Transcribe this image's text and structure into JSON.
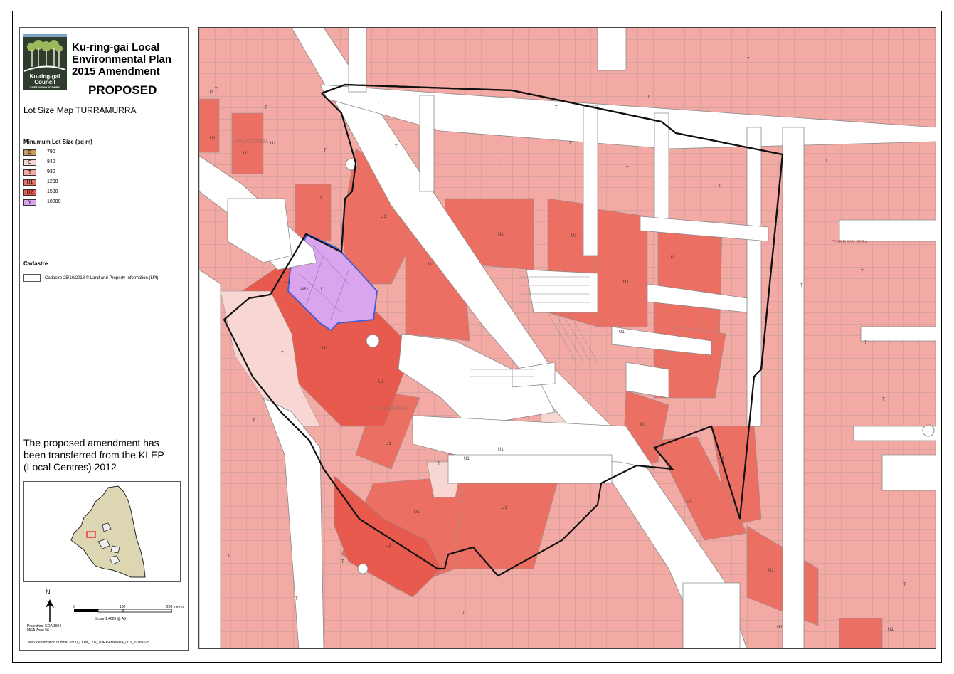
{
  "logo": {
    "name": "Ku-ring-gai",
    "sub": "Council",
    "tagline": "SUSTAINING SYDNEY"
  },
  "header": {
    "title_lines": [
      "Ku-ring-gai Local",
      "Environmental Plan",
      "2015 Amendment"
    ],
    "status": "PROPOSED",
    "map_title": "Lot Size Map TURRAMURRA"
  },
  "legend": {
    "heading": "Minumum Lot Size (sq m)",
    "items": [
      {
        "code": "Q",
        "value": "790",
        "color": "#c99c5a"
      },
      {
        "code": "S",
        "value": "840",
        "color": "#f7d6d3"
      },
      {
        "code": "T",
        "value": "930",
        "color": "#f3a9a4"
      },
      {
        "code": "U1",
        "value": "1200",
        "color": "#ec6f63"
      },
      {
        "code": "U2",
        "value": "1500",
        "color": "#e85a4e"
      },
      {
        "code": "Y",
        "value": "10000",
        "color": "#dba4ee"
      }
    ]
  },
  "cadastre": {
    "heading": "Cadastre",
    "item": "Cadastre 25/10/2018 © Land and Property Information (LPI)"
  },
  "note": "The proposed amendment has been transferred from the KLEP (Local Centres) 2012",
  "north": "N",
  "scale": {
    "zero": "0",
    "mid": "100",
    "max": "200 metres",
    "text": "Scale 1:4620 @ A3"
  },
  "projection": [
    "Projection: GDA 1994",
    "MGA Zone 56"
  ],
  "map_id": "Map identification number   6500_COM_LZN_TURRAMURRA_003_20181025",
  "map_labels": {
    "suburb_1": "WAHROONGA",
    "suburb_2": "TURRAMURRA",
    "suburb_3": "TURRAMURRA",
    "ar1": "AR1",
    "x": "X"
  },
  "zone_labels": [
    "T",
    "U1",
    "U2"
  ]
}
